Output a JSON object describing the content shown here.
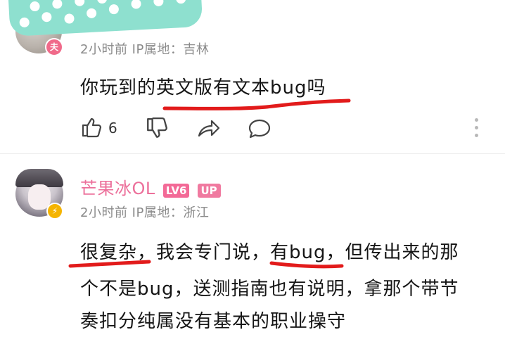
{
  "comment1": {
    "badge": "夫",
    "meta": "2小时前  IP属地：吉林",
    "text": "你玩到的英文版有文本bug吗",
    "like_count": "6",
    "icons": [
      "thumbs-up-icon",
      "thumbs-down-icon",
      "share-icon",
      "comment-icon",
      "more-icon"
    ]
  },
  "comment2": {
    "username": "芒果冰OL",
    "level_badge": "LV6",
    "up_badge": "UP",
    "meta": "2小时前  IP属地：浙江",
    "lines": [
      "很复杂，我会专门说，有bug，但传出来的那",
      "个不是bug，送测指南也有说明，拿那个带节",
      "奏扣分纯属没有基本的职业操守"
    ]
  },
  "colors": {
    "mask": "#8ee0cf",
    "username": "#ec6f9a",
    "underline": "#e21b1b",
    "meta": "#8a8a8a",
    "badge_vip": "#f06a8a",
    "badge_verified": "#f5b400"
  }
}
